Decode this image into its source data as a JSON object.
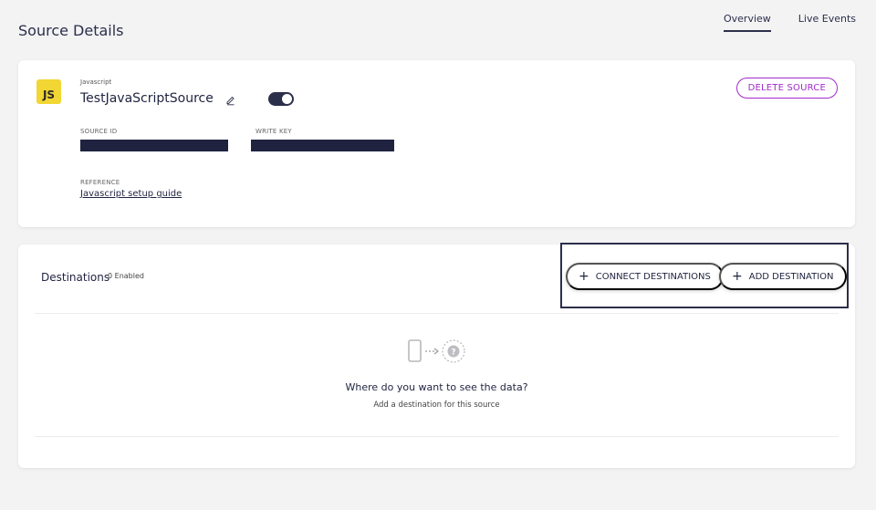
{
  "page": {
    "title": "Source Details"
  },
  "tabs": [
    {
      "label": "Overview",
      "active": true
    },
    {
      "label": "Live Events",
      "active": false
    }
  ],
  "source": {
    "logo_text": "JS",
    "type": "Javascript",
    "name": "TestJavaScriptSource",
    "enabled": true,
    "delete_label": "DELETE SOURCE",
    "source_id_label": "SOURCE ID",
    "write_key_label": "WRITE KEY",
    "reference_label": "REFERENCE",
    "reference_link": "Javascript setup guide"
  },
  "destinations": {
    "title": "Destinations",
    "count": "0 Enabled",
    "connect_label": "CONNECT DESTINATIONS",
    "add_label": "ADD DESTINATION",
    "empty_title": "Where do you want to see the data?",
    "empty_subtitle": "Add a destination for this source"
  },
  "colors": {
    "accent": "#2b2f4a",
    "delete": "#a22bc9",
    "js_yellow": "#f2d633",
    "background": "#f3f3f4"
  }
}
